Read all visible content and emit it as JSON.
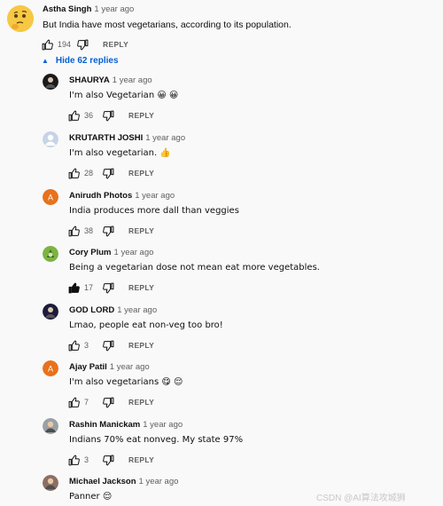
{
  "top_comment": {
    "author": "Astha Singh",
    "time": "1 year ago",
    "text": "But India have most vegetarians, according to its population.",
    "likes": "194",
    "reply_label": "REPLY"
  },
  "hide_replies": {
    "label": "Hide 62 replies",
    "icon": "caret-up-icon"
  },
  "replies": [
    {
      "author": "SHAURYA",
      "time": "1 year ago",
      "text": "I'm also  Vegetarian 😀 😀",
      "likes": "36",
      "reply_label": "REPLY",
      "liked": false,
      "avatar": {
        "kind": "photo-dark",
        "color": "#1a1a1a"
      }
    },
    {
      "author": "KRUTARTH JOSHI",
      "time": "1 year ago",
      "text": "I'm also vegetarian. 👍",
      "likes": "28",
      "reply_label": "REPLY",
      "liked": false,
      "avatar": {
        "kind": "default-silhouette",
        "color": "#c7d3e6"
      }
    },
    {
      "author": "Anirudh Photos",
      "time": "1 year ago",
      "text": "India produces more dall than veggies",
      "likes": "38",
      "reply_label": "REPLY",
      "liked": false,
      "avatar": {
        "kind": "letter",
        "letter": "A",
        "color": "#e8711c"
      }
    },
    {
      "author": "Cory Plum",
      "time": "1 year ago",
      "text": "Being a vegetarian dose not mean eat more vegetables.",
      "likes": "17",
      "reply_label": "REPLY",
      "liked": true,
      "avatar": {
        "kind": "photo-green",
        "color": "#7cb342"
      }
    },
    {
      "author": "GOD LORD",
      "time": "1 year ago",
      "text": "Lmao, people eat non-veg too bro!",
      "likes": "3",
      "reply_label": "REPLY",
      "liked": false,
      "avatar": {
        "kind": "photo-dark",
        "color": "#1c1c3a"
      }
    },
    {
      "author": "Ajay Patil",
      "time": "1 year ago",
      "text": "I'm also vegetarians 😋 😌",
      "likes": "7",
      "reply_label": "REPLY",
      "liked": false,
      "avatar": {
        "kind": "letter",
        "letter": "A",
        "color": "#e8711c"
      }
    },
    {
      "author": "Rashin Manickam",
      "time": "1 year ago",
      "text": "Indians 70% eat nonveg. My state 97%",
      "likes": "3",
      "reply_label": "REPLY",
      "liked": false,
      "avatar": {
        "kind": "photo-person",
        "color": "#9aa0a6"
      }
    },
    {
      "author": "Michael Jackson",
      "time": "1 year ago",
      "text": "Panner 😌",
      "likes": "",
      "reply_label": "",
      "liked": false,
      "avatar": {
        "kind": "photo-person",
        "color": "#8d6e63"
      }
    }
  ],
  "watermark": "CSDN @AI算法攻城狮",
  "colors": {
    "link": "#065fd4",
    "meta": "#606060",
    "text": "#0f0f0f",
    "background": "#f9f9f9"
  }
}
